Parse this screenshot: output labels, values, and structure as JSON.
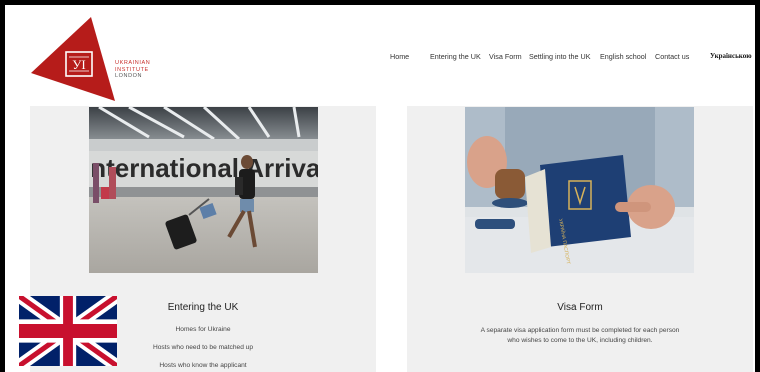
{
  "brand": {
    "line1": "UKRAINIAN",
    "line2": "INSTITUTE",
    "line3": "LONDON",
    "monogram": "УІ",
    "red": "#b61c1a"
  },
  "nav": {
    "items": [
      {
        "label": "Home"
      },
      {
        "label": "Entering the UK"
      },
      {
        "label": "Visa Form"
      },
      {
        "label": "Settling into the UK"
      },
      {
        "label": "English school"
      },
      {
        "label": "Contact us"
      }
    ],
    "language": "Українською"
  },
  "cards": {
    "entering": {
      "photo_text": "International Arrivals",
      "title": "Entering the UK",
      "links": [
        "Homes for Ukraine",
        "Hosts who need to be matched up",
        "Hosts who know the applicant"
      ]
    },
    "visa": {
      "passport_text": "УКРАЇНА ПАСПОРТ",
      "title": "Visa Form",
      "desc_line1": "A separate visa application form must be completed for each person",
      "desc_line2": "who wishes to come to the UK, including children."
    }
  },
  "icons": {
    "logo": "triangle-logo-icon",
    "flag": "uk-flag-icon"
  }
}
